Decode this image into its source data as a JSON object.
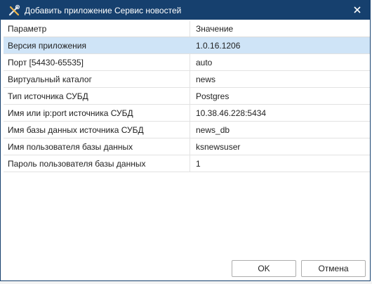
{
  "dialog": {
    "title": "Добавить приложение Сервис новостей",
    "accent_color": "#16406e",
    "selection_color": "#cfe4f7"
  },
  "grid": {
    "headers": {
      "param": "Параметр",
      "value": "Значение"
    },
    "rows": [
      {
        "param": "Версия приложения",
        "value": "1.0.16.1206",
        "selected": true
      },
      {
        "param": "Порт [54430-65535]",
        "value": "auto"
      },
      {
        "param": "Виртуальный каталог",
        "value": "news"
      },
      {
        "param": "Тип источника СУБД",
        "value": "Postgres"
      },
      {
        "param": "Имя или ip:port источника СУБД",
        "value": "10.38.46.228:5434"
      },
      {
        "param": "Имя базы данных источника СУБД",
        "value": "news_db"
      },
      {
        "param": "Имя пользователя базы данных",
        "value": "ksnewsuser"
      },
      {
        "param": "Пароль пользователя базы данных",
        "value": "1"
      }
    ]
  },
  "buttons": {
    "ok": "OK",
    "cancel": "Отмена"
  },
  "icons": {
    "app": "tools-icon",
    "close": "close-icon"
  }
}
